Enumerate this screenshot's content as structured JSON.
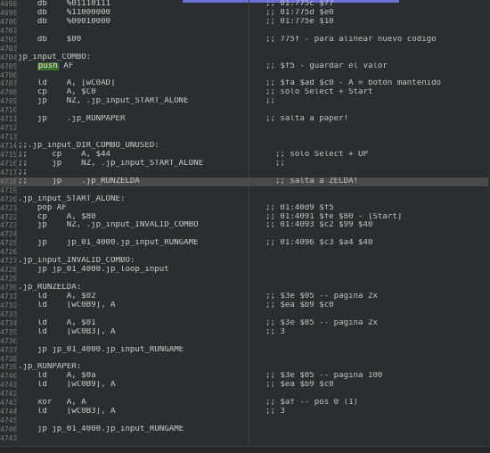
{
  "editor": {
    "lines": [
      {
        "ln": "4698",
        "code": "    db    %01110111",
        "comment": ";; 01:775c $77"
      },
      {
        "ln": "4699",
        "code": "    db    %11000000",
        "comment": ";; 01:775d $e0"
      },
      {
        "ln": "4700",
        "code": "    db    %00010000",
        "comment": ";; 01:775e $10"
      },
      {
        "ln": "4701",
        "code": "",
        "comment": ""
      },
      {
        "ln": "4702",
        "code": "    db    $00",
        "comment": ";; 775f - para alinear nuevo codigo"
      },
      {
        "ln": "4703",
        "code": "",
        "comment": ""
      },
      {
        "ln": "4704",
        "code": "jp_input_COMBO:",
        "comment": ""
      },
      {
        "ln": "4705",
        "code": "    ",
        "push": "push",
        "code_after": " AF",
        "comment": ";; $f5 - guardar el valor"
      },
      {
        "ln": "4706",
        "code": "",
        "comment": ""
      },
      {
        "ln": "4707",
        "code": "    ld    A, [wC0AD]",
        "comment": ";; $fa $ad $c0 - A = botón mantenido"
      },
      {
        "ln": "4708",
        "code": "    cp    A, $C0",
        "comment": ";; solo Select + Start"
      },
      {
        "ln": "4709",
        "code": "    jp    NZ, .jp_input_START_ALONE",
        "comment": ";;"
      },
      {
        "ln": "4710",
        "code": "",
        "comment": ""
      },
      {
        "ln": "4711",
        "code": "    jp    .jp_RUNPAPER",
        "comment": ";; salta a paper!"
      },
      {
        "ln": "4712",
        "code": "",
        "comment": ""
      },
      {
        "ln": "4713",
        "code": "",
        "comment": ""
      },
      {
        "ln": "4714",
        "code": ";;.jp_input_DIR_COMBO_UNUSED:",
        "comment": ""
      },
      {
        "ln": "4715",
        "code": ";;     cp    A, $44",
        "comment": "  ;; solo Select + UP"
      },
      {
        "ln": "4716",
        "code": ";;     jp    NZ, .jp_input_START_ALONE",
        "comment": "  ;;"
      },
      {
        "ln": "4717",
        "code": ";;",
        "comment": ""
      },
      {
        "ln": "4718",
        "code": ";;     jp    .jp_RUNZELDA",
        "comment": "  ;; salta a ZELDA!",
        "highlight": true
      },
      {
        "ln": "4719",
        "code": "",
        "comment": ""
      },
      {
        "ln": "4720",
        "code": ".jp_input_START_ALONE:",
        "comment": ""
      },
      {
        "ln": "4721",
        "code": "    pop AF",
        "comment": ";; 01:40d9 $f5"
      },
      {
        "ln": "4722",
        "code": "    cp    A, $80",
        "comment": ";; 01:4091 $fe $80 - [Start]"
      },
      {
        "ln": "4723",
        "code": "    jp    NZ, .jp_input_INVALID_COMBO",
        "comment": ";; 01:4093 $c2 $99 $40"
      },
      {
        "ln": "4724",
        "code": "",
        "comment": ""
      },
      {
        "ln": "4725",
        "code": "    jp    jp_01_4000.jp_input_RUNGAME",
        "comment": ";; 01:4096 $c3 $a4 $40"
      },
      {
        "ln": "4726",
        "code": "",
        "comment": ""
      },
      {
        "ln": "4727",
        "code": ".jp_input_INVALID_COMBO:",
        "comment": ""
      },
      {
        "ln": "4728",
        "code": "    jp jp_01_4000.jp_loop_input",
        "comment": ""
      },
      {
        "ln": "4729",
        "code": "",
        "comment": ""
      },
      {
        "ln": "4730",
        "code": ".jp_RUNZELDA:",
        "comment": ""
      },
      {
        "ln": "4731",
        "code": "    ld    A, $02",
        "comment": ";; $3e $05 -- pagina 2x"
      },
      {
        "ln": "4732",
        "code": "    ld    [wC0B9], A",
        "comment": ";; $ea $b9 $c0"
      },
      {
        "ln": "4733",
        "code": "",
        "comment": ""
      },
      {
        "ln": "4734",
        "code": "    ld    A, $01",
        "comment": ";; $3e $05 -- pagina 2x"
      },
      {
        "ln": "4735",
        "code": "    ld    [wC0B3], A",
        "comment": ";; 3"
      },
      {
        "ln": "4736",
        "code": "",
        "comment": ""
      },
      {
        "ln": "4737",
        "code": "    jp jp_01_4000.jp_input_RUNGAME",
        "comment": ""
      },
      {
        "ln": "4738",
        "code": "",
        "comment": ""
      },
      {
        "ln": "4739",
        "code": ".jp_RUNPAPER:",
        "comment": ""
      },
      {
        "ln": "4740",
        "code": "    ld    A, $0a",
        "comment": ";; $3e $05 -- pagina 100"
      },
      {
        "ln": "4741",
        "code": "    ld    [wC0B9], A",
        "comment": ";; $ea $b9 $c0"
      },
      {
        "ln": "4742",
        "code": "",
        "comment": ""
      },
      {
        "ln": "4743",
        "code": "    xor   A, A",
        "comment": ";; $af -- pos 0 (1)"
      },
      {
        "ln": "4744",
        "code": "    ld    [wC0B3], A",
        "comment": ";; 3"
      },
      {
        "ln": "4745",
        "code": "",
        "comment": ""
      },
      {
        "ln": "4746",
        "code": "    jp jp_01_4000.jp_input_RUNGAME",
        "comment": ""
      },
      {
        "ln": "4747",
        "code": "",
        "comment": ""
      }
    ]
  },
  "colors": {
    "background": "#2b2e30",
    "highlight_line": "#474a47",
    "push_keyword_bg": "#3d6e2e",
    "accent_bar": "#6b6fd8"
  }
}
